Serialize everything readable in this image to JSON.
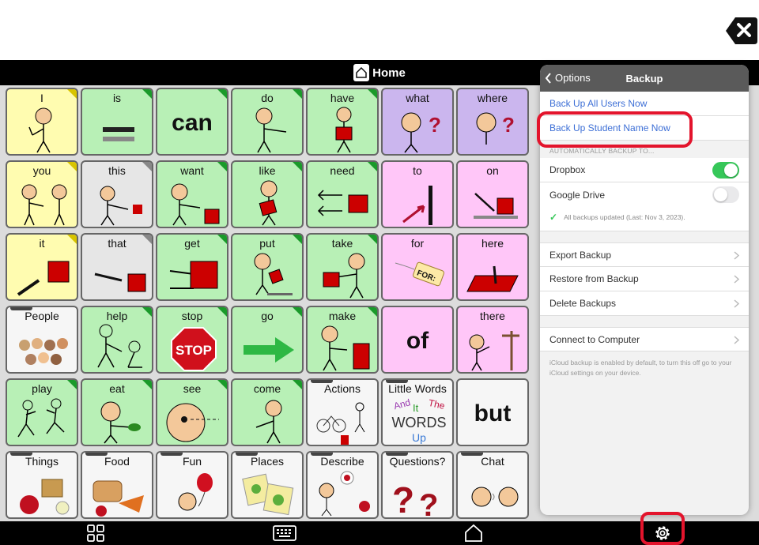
{
  "titlebar": {
    "title": "Home"
  },
  "grid": {
    "rows": [
      [
        {
          "label": "I",
          "color": "yellow",
          "corner": "yellow"
        },
        {
          "label": "is",
          "color": "green",
          "corner": "green"
        },
        {
          "label": "",
          "big": "can",
          "color": "green",
          "corner": "green"
        },
        {
          "label": "do",
          "color": "green",
          "corner": "green"
        },
        {
          "label": "have",
          "color": "green",
          "corner": "green"
        },
        {
          "label": "what",
          "color": "purple",
          "corner": ""
        },
        {
          "label": "where",
          "color": "purple",
          "corner": ""
        }
      ],
      [
        {
          "label": "you",
          "color": "yellow",
          "corner": "yellow"
        },
        {
          "label": "this",
          "color": "gray",
          "corner": "gray"
        },
        {
          "label": "want",
          "color": "green",
          "corner": "green"
        },
        {
          "label": "like",
          "color": "green",
          "corner": "green"
        },
        {
          "label": "need",
          "color": "green",
          "corner": "green"
        },
        {
          "label": "to",
          "color": "pink",
          "corner": ""
        },
        {
          "label": "on",
          "color": "pink",
          "corner": ""
        }
      ],
      [
        {
          "label": "it",
          "color": "yellow",
          "corner": "yellow"
        },
        {
          "label": "that",
          "color": "gray",
          "corner": "gray"
        },
        {
          "label": "get",
          "color": "green",
          "corner": "green"
        },
        {
          "label": "put",
          "color": "green",
          "corner": "green"
        },
        {
          "label": "take",
          "color": "green",
          "corner": "green"
        },
        {
          "label": "for",
          "color": "pink",
          "corner": ""
        },
        {
          "label": "here",
          "color": "pink",
          "corner": ""
        }
      ],
      [
        {
          "label": "People",
          "color": "white",
          "corner": "",
          "folder": true
        },
        {
          "label": "help",
          "color": "green",
          "corner": "green"
        },
        {
          "label": "stop",
          "color": "green",
          "corner": "green"
        },
        {
          "label": "go",
          "color": "green",
          "corner": "green"
        },
        {
          "label": "make",
          "color": "green",
          "corner": "green"
        },
        {
          "label": "",
          "big": "of",
          "color": "pink",
          "corner": ""
        },
        {
          "label": "there",
          "color": "pink",
          "corner": ""
        }
      ],
      [
        {
          "label": "play",
          "color": "green",
          "corner": "green"
        },
        {
          "label": "eat",
          "color": "green",
          "corner": "green"
        },
        {
          "label": "see",
          "color": "green",
          "corner": "green"
        },
        {
          "label": "come",
          "color": "green",
          "corner": "green"
        },
        {
          "label": "Actions",
          "color": "white",
          "corner": "",
          "folder": true
        },
        {
          "label": "Little Words",
          "color": "white",
          "corner": "",
          "folder": true
        },
        {
          "label": "",
          "big": "but",
          "color": "white",
          "corner": ""
        }
      ],
      [
        {
          "label": "Things",
          "color": "white",
          "corner": "",
          "folder": true
        },
        {
          "label": "Food",
          "color": "white",
          "corner": "",
          "folder": true
        },
        {
          "label": "Fun",
          "color": "white",
          "corner": "",
          "folder": true
        },
        {
          "label": "Places",
          "color": "white",
          "corner": "",
          "folder": true
        },
        {
          "label": "Describe",
          "color": "white",
          "corner": "",
          "folder": true
        },
        {
          "label": "Questions?",
          "color": "white",
          "corner": "",
          "folder": true
        },
        {
          "label": "Chat",
          "color": "white",
          "corner": "",
          "folder": true
        }
      ]
    ],
    "stop_sign_text": "STOP",
    "for_tag_text": "FOR:",
    "little_words": [
      "And",
      "It",
      "The",
      "WORDS",
      "Up"
    ]
  },
  "panel": {
    "back_label": "Options",
    "title": "Backup",
    "backup_all": "Back Up All Users Now",
    "backup_student": "Back Up Student Name Now",
    "auto_section": "AUTOMATICALLY BACKUP TO...",
    "dropbox": "Dropbox",
    "google_drive": "Google Drive",
    "status": "All backups updated (Last: Nov 3, 2023).",
    "export": "Export Backup",
    "restore": "Restore from Backup",
    "delete": "Delete Backups",
    "connect": "Connect to Computer",
    "footnote": "iCloud backup is enabled by default, to turn this off go to your iCloud settings on your device."
  },
  "colors": {
    "yellow": "#fffcb0",
    "green": "#b8f0b6",
    "gray": "#e6e6e6",
    "purple": "#cbb6ee",
    "pink": "#ffc6f8",
    "white": "#f6f6f6",
    "toggle_on": "#36c759",
    "highlight": "#e3142c",
    "link": "#3d6fd6"
  },
  "icons": {
    "close": "close-x-icon",
    "home": "home-icon",
    "grid": "grid-icon",
    "keyboard": "keyboard-icon",
    "home_outline": "home-outline-icon",
    "settings": "gear-icon"
  }
}
